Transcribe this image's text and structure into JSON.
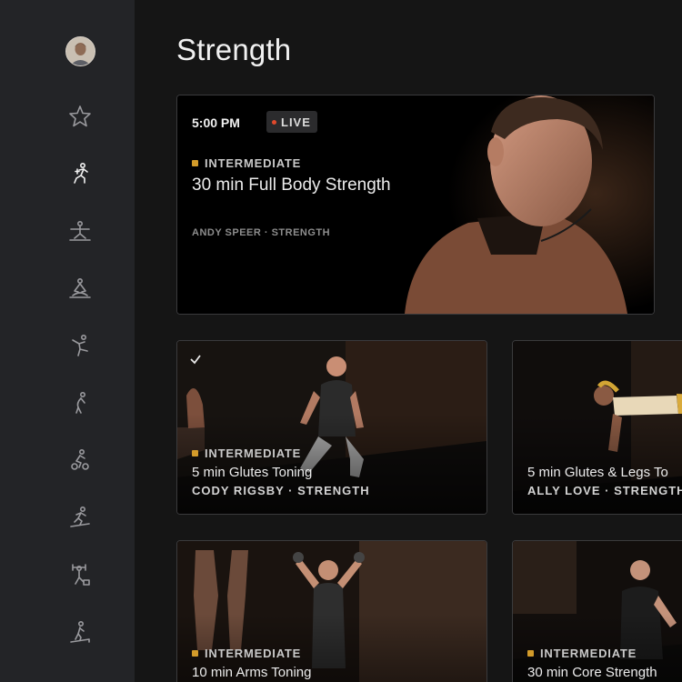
{
  "page": {
    "title": "Strength"
  },
  "sidebar": {
    "items": [
      {
        "icon": "star-icon",
        "active": false
      },
      {
        "icon": "strength-icon",
        "active": true
      },
      {
        "icon": "yoga-icon",
        "active": false
      },
      {
        "icon": "meditation-icon",
        "active": false
      },
      {
        "icon": "cardio-icon",
        "active": false
      },
      {
        "icon": "stretching-icon",
        "active": false
      },
      {
        "icon": "cycling-icon",
        "active": false
      },
      {
        "icon": "running-icon",
        "active": false
      },
      {
        "icon": "bootcamp-icon",
        "active": false
      },
      {
        "icon": "walking-icon",
        "active": false
      }
    ]
  },
  "hero": {
    "time": "5:00 PM",
    "live_label": "LIVE",
    "level": "INTERMEDIATE",
    "title": "30 min Full Body Strength",
    "instructor": "ANDY SPEER · STRENGTH"
  },
  "classes": [
    {
      "level": "INTERMEDIATE",
      "title": "5 min Glutes Toning",
      "instructor": "CODY RIGSBY · STRENGTH",
      "completed": true
    },
    {
      "level": "",
      "title": "5 min Glutes & Legs To",
      "instructor": "ALLY LOVE · STRENGTH",
      "completed": false
    },
    {
      "level": "INTERMEDIATE",
      "title": "10 min Arms Toning",
      "instructor": "",
      "completed": false
    },
    {
      "level": "INTERMEDIATE",
      "title": "30 min Core Strength",
      "instructor": "",
      "completed": false
    }
  ],
  "colors": {
    "accent_level": "#d39b2a",
    "live_dot": "#e0492c",
    "sidebar_bg": "#232427",
    "main_bg": "#151515"
  }
}
